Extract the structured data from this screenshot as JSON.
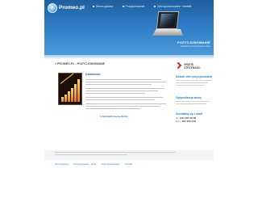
{
  "header": {
    "logo_text": "Promeo.pl",
    "nav": [
      {
        "label": "Strona główna"
      },
      {
        "label": "Pozycjonowanie"
      },
      {
        "label": "Linki sponsorowane / kontakt"
      }
    ],
    "hero_title": "POZYCJONOWANIE",
    "hero_subtitle": "skuteczne pozycjonowanie stron"
  },
  "breadcrumb": "» PROMEO.PL - POZYCJONOWANIE",
  "content": {
    "title": "Działalność",
    "cta": "Sprawdź naszą ofertę!"
  },
  "sidebar": {
    "promo": [
      "GRATIS",
      "OTRZYMASZ:"
    ],
    "sections": [
      {
        "title": "Dodatk. ofert pozycjonowania"
      },
      {
        "title": "Optymalizacja strony"
      },
      {
        "title": "Skontaktuj się z nami!"
      }
    ],
    "phone_label": "tel.",
    "phone": "(22) 397 98 68",
    "mobile_label": "kom.",
    "mobile": "697 650 649"
  },
  "footer": {
    "links": [
      "Strona główna",
      "Pozycjonowanie - oferta",
      "Linki sponsorowane",
      "Kontakt"
    ]
  },
  "colors": {
    "header_blue": "#2d7bc4",
    "link_blue": "#1f6fb5",
    "accent_red": "#c8262c"
  }
}
